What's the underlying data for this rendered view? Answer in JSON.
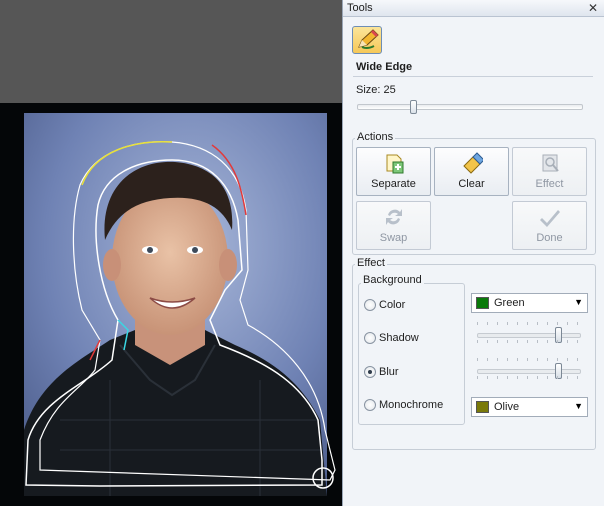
{
  "tools_panel": {
    "title": "Tools",
    "close_glyph": "✕",
    "tool_name": "Wide Edge",
    "size_label": "Size: 25",
    "size_value": 25
  },
  "actions": {
    "title": "Actions",
    "buttons": [
      {
        "label": "Separate",
        "icon": "separate-icon",
        "enabled": true
      },
      {
        "label": "Clear",
        "icon": "eraser-icon",
        "enabled": true
      },
      {
        "label": "Effect",
        "icon": "effect-icon",
        "enabled": false
      },
      {
        "label": "Swap",
        "icon": "swap-icon",
        "enabled": false
      },
      {
        "label": "Done",
        "icon": "checkmark-icon",
        "enabled": false
      }
    ]
  },
  "effect": {
    "title": "Effect",
    "background_title": "Background",
    "options": [
      {
        "label": "Color",
        "selected": false
      },
      {
        "label": "Shadow",
        "selected": false
      },
      {
        "label": "Blur",
        "selected": true
      },
      {
        "label": "Monochrome",
        "selected": false
      }
    ],
    "color_select": {
      "value": "Green",
      "swatch": "#0a7a0a"
    },
    "mono_select": {
      "value": "Olive",
      "swatch": "#7a7a0a"
    },
    "shadow_level": 0.8,
    "blur_level": 0.8
  },
  "colors": {
    "panel_bg": "#f1f4f8",
    "canvas_gray": "#565656",
    "canvas_black": "#040608"
  }
}
